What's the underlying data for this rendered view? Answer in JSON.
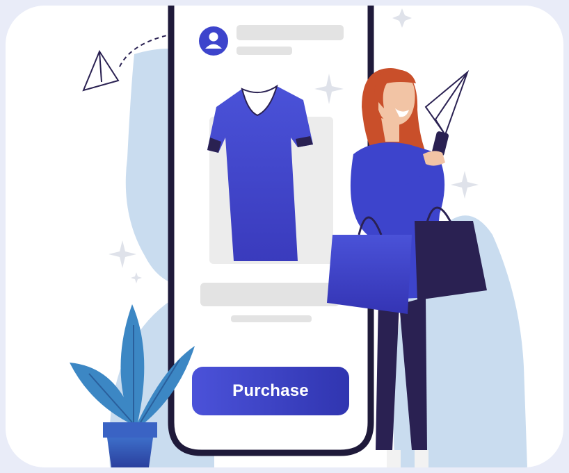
{
  "screen": {
    "purchase_label": "Purchase"
  },
  "colors": {
    "page_bg": "#e9ecf8",
    "card_bg": "#ffffff",
    "blob": "#c9dcef",
    "phone_frame": "#1f1a3a",
    "accent": "#3d44cc",
    "dark_navy": "#2a2152",
    "placeholder": "#e0e0e0",
    "hair": "#c94f2a",
    "leaf": "#3c87c4"
  },
  "icons": [
    "avatar-icon",
    "paper-plane-icon",
    "sparkle-icon",
    "shirt-icon",
    "shopping-bag-icon",
    "plant-icon"
  ]
}
